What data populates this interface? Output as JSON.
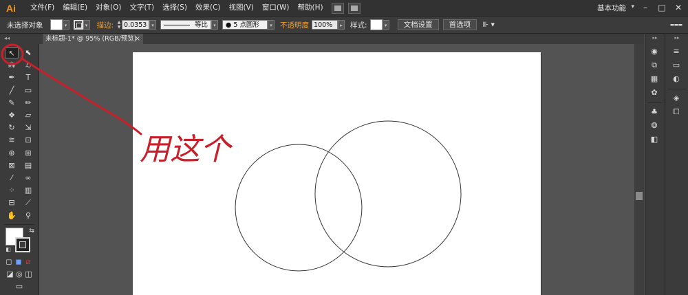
{
  "app": {
    "logo": "Ai"
  },
  "menu": [
    "文件(F)",
    "编辑(E)",
    "对象(O)",
    "文字(T)",
    "选择(S)",
    "效果(C)",
    "视图(V)",
    "窗口(W)",
    "帮助(H)"
  ],
  "workspace": {
    "label": "基本功能",
    "chevron": "▾"
  },
  "window_controls": {
    "minimize": "–",
    "maximize": "□",
    "close": "✕"
  },
  "controlbar": {
    "selection_status": "未选择对象",
    "stroke_label": "描边:",
    "stroke_weight": "0.0353",
    "stroke_style": "等比",
    "brush_size": "5 点圆形",
    "opacity_label": "不透明度",
    "opacity_value": "100%",
    "style_label": "样式:",
    "doc_setup": "文档设置",
    "preferences": "首选项"
  },
  "document_tab": {
    "title": "未标题-1* @ 95% (RGB/预览)",
    "close": "×"
  },
  "annotation": {
    "text": "用这个",
    "color": "#c8202a"
  },
  "colors": {
    "accent": "#f7941d",
    "annotation": "#c8202a",
    "ui_bg": "#535353"
  },
  "tools": [
    {
      "name": "selection-tool-icon",
      "glyph": "↖"
    },
    {
      "name": "direct-selection-tool-icon",
      "glyph": "⬉"
    },
    {
      "name": "magic-wand-tool-icon",
      "glyph": "⁂"
    },
    {
      "name": "lasso-tool-icon",
      "glyph": "ℒ"
    },
    {
      "name": "pen-tool-icon",
      "glyph": "✒"
    },
    {
      "name": "type-tool-icon",
      "glyph": "T"
    },
    {
      "name": "line-tool-icon",
      "glyph": "╱"
    },
    {
      "name": "rectangle-tool-icon",
      "glyph": "▭"
    },
    {
      "name": "paintbrush-tool-icon",
      "glyph": "✎"
    },
    {
      "name": "pencil-tool-icon",
      "glyph": "✏"
    },
    {
      "name": "blob-brush-tool-icon",
      "glyph": "❖"
    },
    {
      "name": "eraser-tool-icon",
      "glyph": "▱"
    },
    {
      "name": "rotate-tool-icon",
      "glyph": "↻"
    },
    {
      "name": "scale-tool-icon",
      "glyph": "⇲"
    },
    {
      "name": "warp-tool-icon",
      "glyph": "≋"
    },
    {
      "name": "free-transform-tool-icon",
      "glyph": "⊡"
    },
    {
      "name": "shape-builder-tool-icon",
      "glyph": "⊕"
    },
    {
      "name": "perspective-grid-tool-icon",
      "glyph": "⊞"
    },
    {
      "name": "mesh-tool-icon",
      "glyph": "⊠"
    },
    {
      "name": "gradient-tool-icon",
      "glyph": "▤"
    },
    {
      "name": "eyedropper-tool-icon",
      "glyph": "⁄"
    },
    {
      "name": "blend-tool-icon",
      "glyph": "∞"
    },
    {
      "name": "symbol-sprayer-tool-icon",
      "glyph": "⁘"
    },
    {
      "name": "column-graph-tool-icon",
      "glyph": "▥"
    },
    {
      "name": "artboard-tool-icon",
      "glyph": "⊟"
    },
    {
      "name": "slice-tool-icon",
      "glyph": "⟋"
    },
    {
      "name": "hand-tool-icon",
      "glyph": "✋"
    },
    {
      "name": "zoom-tool-icon",
      "glyph": "⚲"
    }
  ],
  "right_dock_a": [
    {
      "name": "color-panel-icon",
      "glyph": "◉"
    },
    {
      "name": "color-guide-panel-icon",
      "glyph": "⧉"
    },
    {
      "name": "swatches-panel-icon",
      "glyph": "▦"
    },
    {
      "name": "brushes-panel-icon",
      "glyph": "✿"
    },
    {
      "name": "symbols-panel-icon",
      "glyph": "♣"
    },
    {
      "name": "graphic-styles-panel-icon",
      "glyph": "❂"
    },
    {
      "name": "appearance-panel-icon",
      "glyph": "◧"
    }
  ],
  "right_dock_b": [
    {
      "name": "stroke-panel-icon",
      "glyph": "≡"
    },
    {
      "name": "gradient-panel-icon",
      "glyph": "▭"
    },
    {
      "name": "transparency-panel-icon",
      "glyph": "◐"
    },
    {
      "name": "layers-panel-icon",
      "glyph": "◈"
    },
    {
      "name": "artboards-panel-icon",
      "glyph": "⧠"
    }
  ]
}
